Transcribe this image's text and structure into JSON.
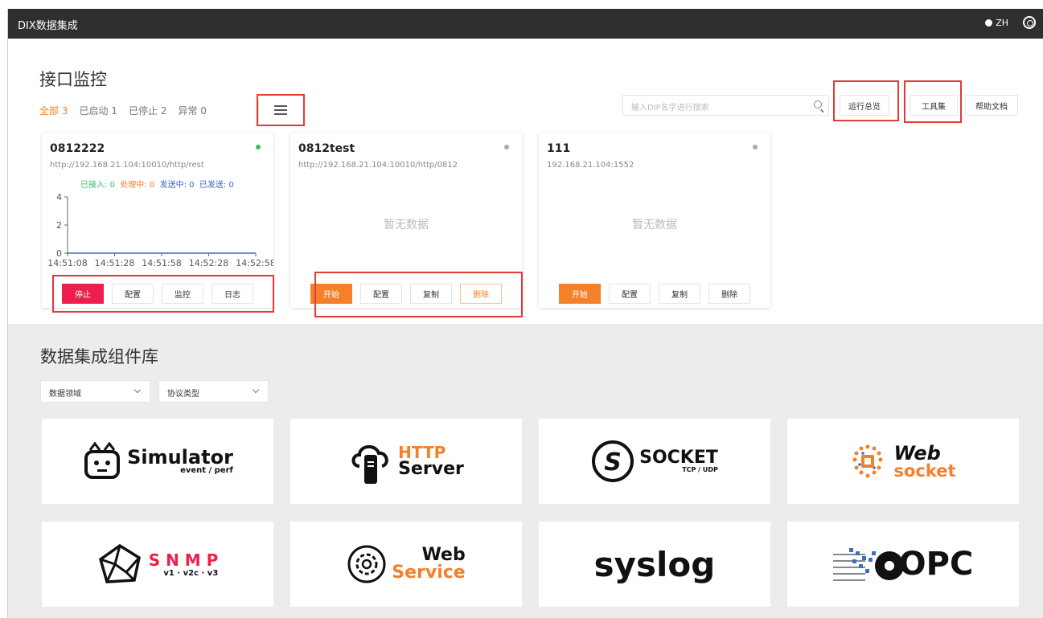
{
  "app": {
    "title": "DIX数据集成",
    "lang": "ZH"
  },
  "monitor": {
    "title": "接口监控",
    "tabs": [
      {
        "label": "全部",
        "count": "3"
      },
      {
        "label": "已启动",
        "count": "1"
      },
      {
        "label": "已停止",
        "count": "2"
      },
      {
        "label": "异常",
        "count": "0"
      }
    ],
    "search_placeholder": "输入DIP名字进行搜索",
    "toolbar": [
      "运行总览",
      "工具集",
      "帮助文档"
    ],
    "cards": [
      {
        "name": "0812222",
        "url": "http://192.168.21.104:10010/http/rest",
        "status": "running",
        "status_color": "#2bbf6a",
        "counts": [
          {
            "label": "已接入:",
            "value": "0",
            "color": "#2bbf6a"
          },
          {
            "label": "处理中:",
            "value": "0",
            "color": "#f5802a"
          },
          {
            "label": "发送中:",
            "value": "0",
            "color": "#3366cc"
          },
          {
            "label": "已发送:",
            "value": "0",
            "color": "#3366cc"
          }
        ],
        "chart_data": {
          "type": "line",
          "x": [
            "14:51:08",
            "14:51:28",
            "14:51:58",
            "14:52:28",
            "14:52:58"
          ],
          "yticks": [
            0,
            2,
            4
          ],
          "ylim": [
            0,
            4
          ],
          "series": [
            {
              "values": [
                0,
                0,
                0,
                0,
                0
              ],
              "color": "#3a6fc4"
            }
          ]
        },
        "buttons": [
          "停止",
          "配置",
          "监控",
          "日志"
        ]
      },
      {
        "name": "0812test",
        "url": "http://192.168.21.104:10010/http/0812",
        "status": "stopped",
        "status_color": "#aaaaaa",
        "empty_text": "暂无数据",
        "buttons": [
          "开始",
          "配置",
          "复制",
          "删除"
        ]
      },
      {
        "name": "111",
        "url": "192.168.21.104:1552",
        "status": "stopped",
        "status_color": "#aaaaaa",
        "empty_text": "暂无数据",
        "buttons": [
          "开始",
          "配置",
          "复制",
          "删除"
        ]
      }
    ]
  },
  "library": {
    "title": "数据集成组件库",
    "filters": [
      "数据领域",
      "协议类型"
    ],
    "components": [
      {
        "id": "simulator",
        "line1": "Simulator",
        "line2": "event / perf"
      },
      {
        "id": "http",
        "line1": "HTTP",
        "line2": "Server"
      },
      {
        "id": "socket",
        "line1": "SOCKET",
        "line2": "TCP / UDP"
      },
      {
        "id": "websocket",
        "line1": "Web",
        "line2": "socket"
      },
      {
        "id": "snmp",
        "line1": "S N M P",
        "line2": "v1 · v2c · v3"
      },
      {
        "id": "webservice",
        "line1": "Web",
        "line2": "Service"
      },
      {
        "id": "syslog",
        "line1": "syslog",
        "line2": ""
      },
      {
        "id": "opc",
        "line1": "OPC",
        "line2": ""
      }
    ]
  }
}
